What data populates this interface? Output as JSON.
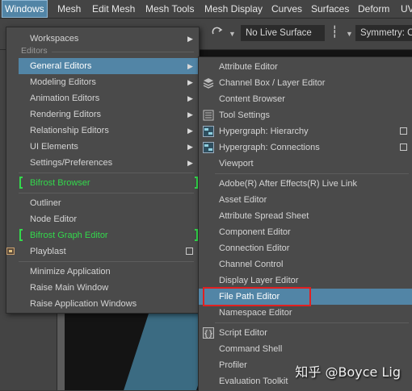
{
  "menubar": [
    "Windows",
    "Mesh",
    "Edit Mesh",
    "Mesh Tools",
    "Mesh Display",
    "Curves",
    "Surfaces",
    "Deform",
    "UV"
  ],
  "toolbar": {
    "live_surface": "No Live Surface",
    "symmetry": "Symmetry: Of"
  },
  "windows_menu": {
    "section_editors": "Editors",
    "items": {
      "workspaces": "Workspaces",
      "general_editors": "General Editors",
      "modeling_editors": "Modeling Editors",
      "animation_editors": "Animation Editors",
      "rendering_editors": "Rendering Editors",
      "relationship_editors": "Relationship Editors",
      "ui_elements": "UI Elements",
      "settings_preferences": "Settings/Preferences",
      "bifrost_browser": "Bifrost Browser",
      "outliner": "Outliner",
      "node_editor": "Node Editor",
      "bifrost_graph_editor": "Bifrost Graph Editor",
      "playblast": "Playblast",
      "minimize_application": "Minimize Application",
      "raise_main_window": "Raise Main Window",
      "raise_application_windows": "Raise Application Windows"
    }
  },
  "general_editors_menu": {
    "items": {
      "attribute_editor": "Attribute Editor",
      "channel_box": "Channel Box / Layer Editor",
      "content_browser": "Content Browser",
      "tool_settings": "Tool Settings",
      "hypergraph_hierarchy": "Hypergraph: Hierarchy",
      "hypergraph_connections": "Hypergraph: Connections",
      "viewport": "Viewport",
      "after_effects_live_link": "Adobe(R) After Effects(R) Live Link",
      "asset_editor": "Asset Editor",
      "attribute_spread_sheet": "Attribute Spread Sheet",
      "component_editor": "Component Editor",
      "connection_editor": "Connection Editor",
      "channel_control": "Channel Control",
      "display_layer_editor": "Display Layer Editor",
      "file_path_editor": "File Path Editor",
      "namespace_editor": "Namespace Editor",
      "script_editor": "Script Editor",
      "command_shell": "Command Shell",
      "profiler": "Profiler",
      "evaluation_toolkit": "Evaluation Toolkit"
    }
  },
  "watermark": "知乎 @Boyce Lig",
  "colors": {
    "highlight": "#5285a6",
    "bifrost_green": "#33d94c",
    "annotation_red": "#e02020"
  }
}
